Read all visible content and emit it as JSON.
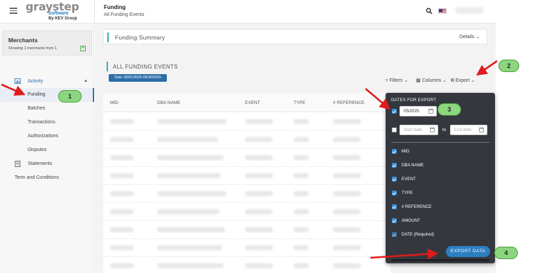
{
  "header": {
    "logo_brand": "graystep",
    "logo_sub1": "software",
    "logo_sub2": "By KEV Group",
    "title": "Funding",
    "subtitle": "All Funding Events"
  },
  "sidebar": {
    "merchants_title": "Merchants",
    "merchants_sub": "Showing 1 merchants from 1",
    "items": [
      {
        "label": "Activity"
      },
      {
        "label": "Funding"
      },
      {
        "label": "Batches"
      },
      {
        "label": "Transactions"
      },
      {
        "label": "Authorizations"
      },
      {
        "label": "Disputes"
      },
      {
        "label": "Statements"
      },
      {
        "label": "Term and Conditions"
      }
    ]
  },
  "main": {
    "summary_title": "Funding Summary",
    "details_label": "Details",
    "events_title": "ALL FUNDING EVENTS",
    "date_badge": "Date: 06/01/2025-06/30/2025",
    "toolbar": {
      "filters": "Filters",
      "columns": "Columns",
      "export": "Export"
    },
    "table": {
      "columns": [
        "MID",
        "DBA NAME",
        "EVENT",
        "TYPE",
        "# REFERENCE"
      ]
    }
  },
  "export_panel": {
    "title": "DATES FOR EXPORT",
    "month_value": "05/2025",
    "start_placeholder": "Start date",
    "end_placeholder": "End date",
    "to_label": "to",
    "columns": [
      {
        "label": "MID",
        "checked": true
      },
      {
        "label": "DBA NAME",
        "checked": true
      },
      {
        "label": "EVENT",
        "checked": true
      },
      {
        "label": "TYPE",
        "checked": true
      },
      {
        "label": "# REFERENCE",
        "checked": true
      },
      {
        "label": "AMOUNT",
        "checked": true
      },
      {
        "label": "DATE (Required)",
        "checked": true
      }
    ],
    "export_button": "EXPORT DATA"
  },
  "annotations": {
    "steps": [
      "1",
      "2",
      "3",
      "4"
    ],
    "arrow_color": "#e01b1b",
    "bubble_color": "#8bd67e"
  }
}
